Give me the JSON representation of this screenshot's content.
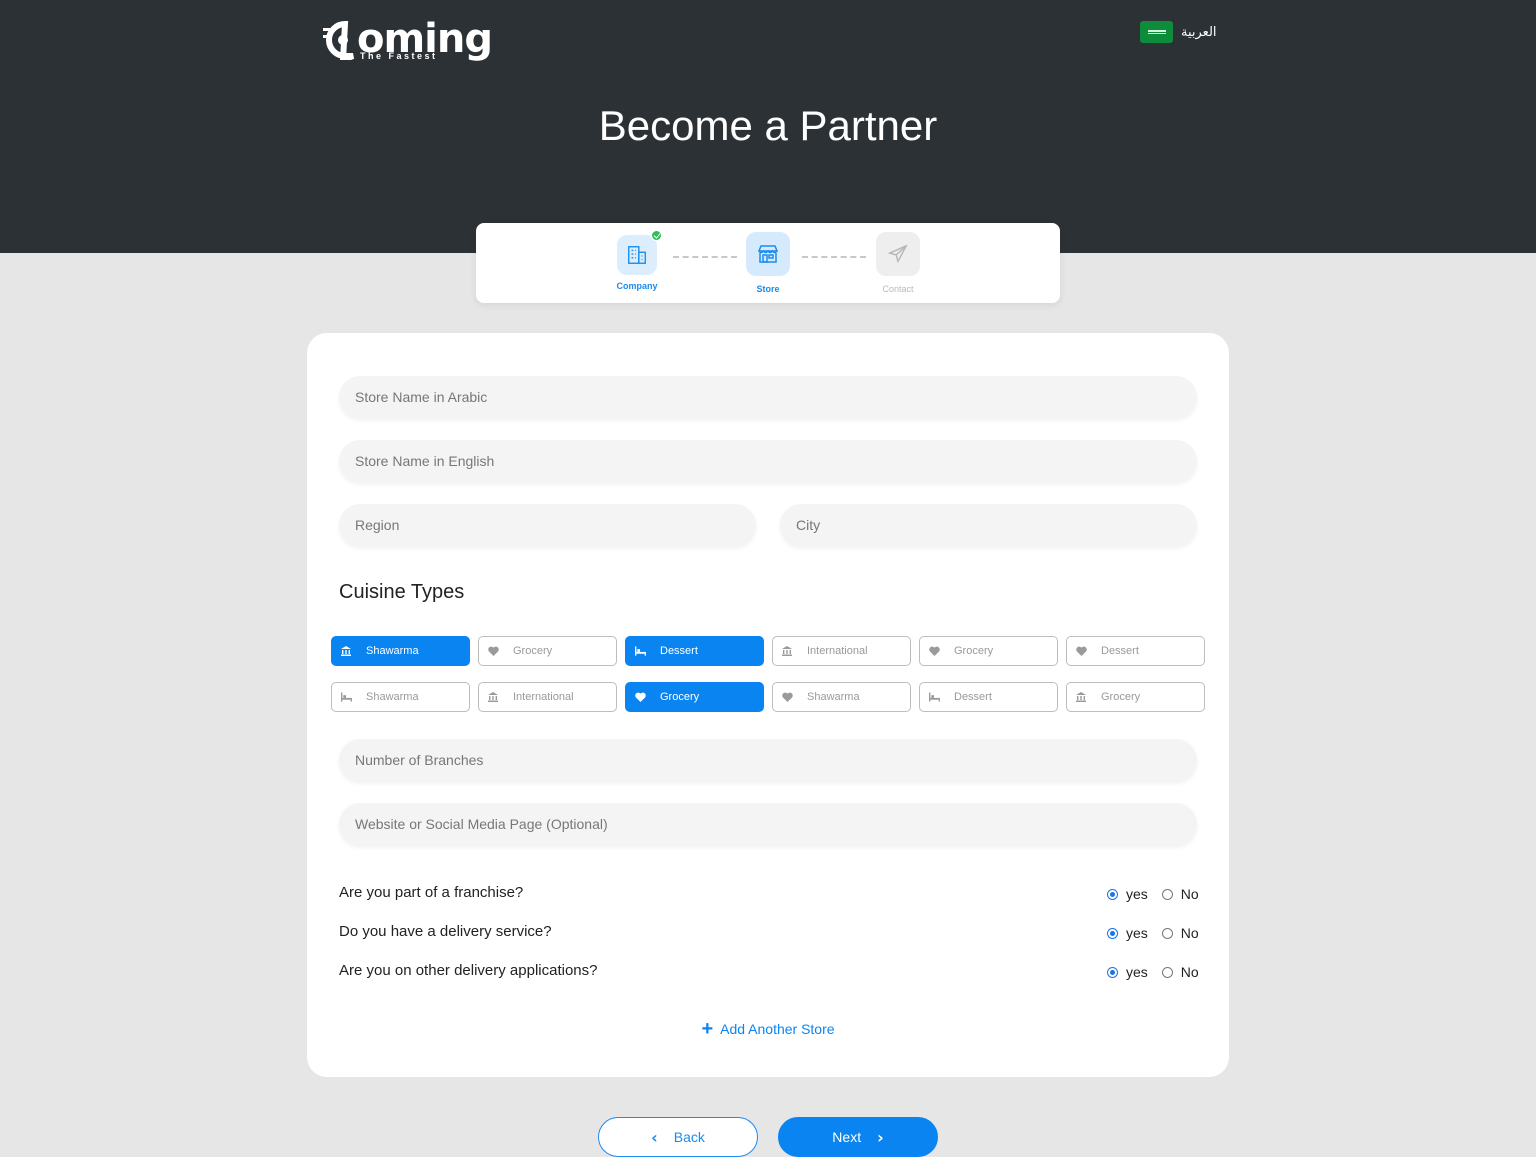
{
  "header": {
    "logo_word": "oming",
    "logo_tagline": "The Fastest",
    "language_label": "العربية",
    "title": "Become a Partner"
  },
  "steps": [
    {
      "label": "Company",
      "icon": "building-icon",
      "state": "completed"
    },
    {
      "label": "Store",
      "icon": "store-icon",
      "state": "active"
    },
    {
      "label": "Contact",
      "icon": "paper-plane-icon",
      "state": "pending"
    }
  ],
  "form": {
    "store_name_ar_placeholder": "Store Name in Arabic",
    "store_name_en_placeholder": "Store Name in English",
    "region_placeholder": "Region",
    "city_placeholder": "City",
    "cuisine_title": "Cuisine Types",
    "cuisines": [
      {
        "label": "Shawarma",
        "icon": "bank-icon",
        "selected": true
      },
      {
        "label": "Grocery",
        "icon": "heart-icon",
        "selected": false
      },
      {
        "label": "Dessert",
        "icon": "bed-icon",
        "selected": true
      },
      {
        "label": "International",
        "icon": "bank-icon",
        "selected": false
      },
      {
        "label": "Grocery",
        "icon": "heart-icon",
        "selected": false
      },
      {
        "label": "Dessert",
        "icon": "heart-icon",
        "selected": false
      },
      {
        "label": "Shawarma",
        "icon": "bed-icon",
        "selected": false
      },
      {
        "label": "International",
        "icon": "bank-icon",
        "selected": false
      },
      {
        "label": "Grocery",
        "icon": "heart-icon",
        "selected": true
      },
      {
        "label": "Shawarma",
        "icon": "heart-icon",
        "selected": false
      },
      {
        "label": "Dessert",
        "icon": "bed-icon",
        "selected": false
      },
      {
        "label": "Grocery",
        "icon": "bank-icon",
        "selected": false
      }
    ],
    "branches_placeholder": "Number of Branches",
    "website_placeholder": "Website or Social Media Page (Optional)",
    "questions": [
      {
        "text": "Are you part of a franchise?",
        "yes": "yes",
        "no": "No",
        "value": "yes"
      },
      {
        "text": "Do you have a delivery service?",
        "yes": "yes",
        "no": "No",
        "value": "yes"
      },
      {
        "text": "Are you on other delivery applications?",
        "yes": "yes",
        "no": "No",
        "value": "yes"
      }
    ],
    "add_store_label": "Add Another Store"
  },
  "nav": {
    "back_label": "Back",
    "next_label": "Next"
  },
  "colors": {
    "header_bg": "#2b3135",
    "accent": "#0a84f1",
    "page_bg": "#e6e6e6",
    "success": "#2ebd59"
  }
}
